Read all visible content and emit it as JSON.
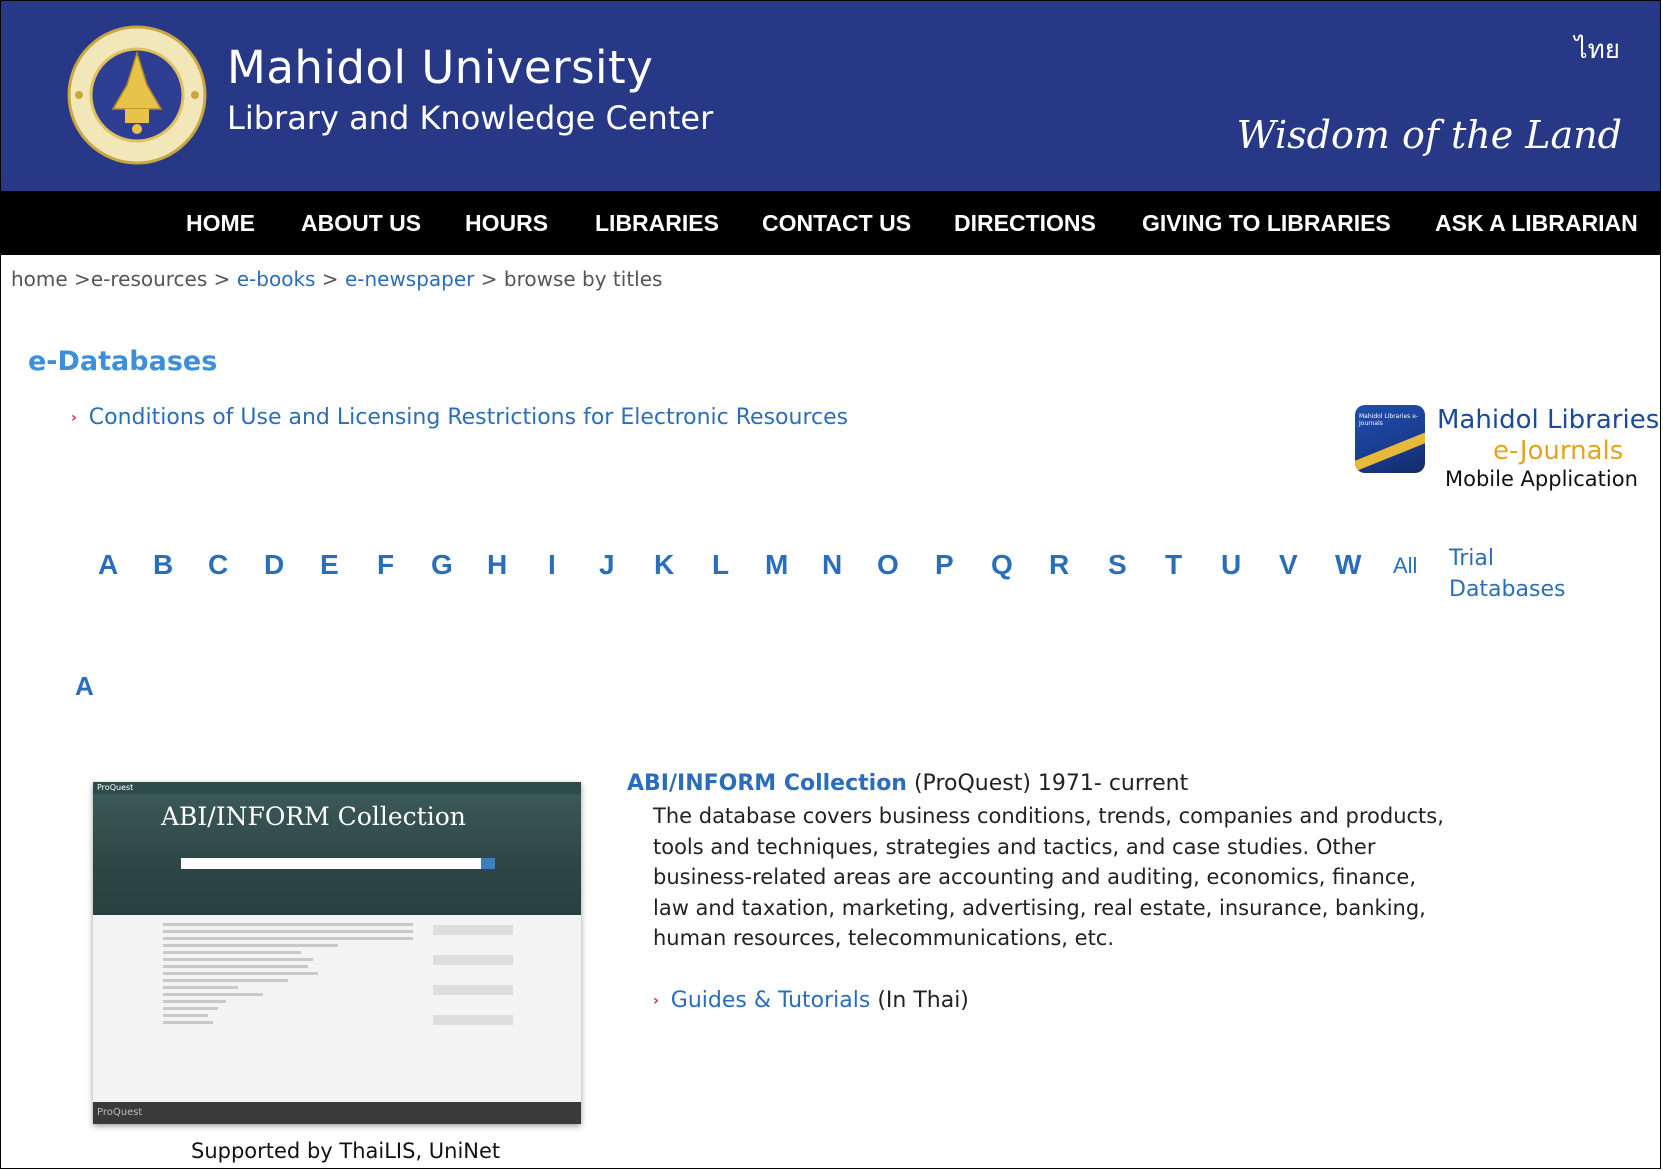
{
  "header": {
    "title": "Mahidol University",
    "subtitle": "Library and Knowledge Center",
    "lang_link": "ไทย",
    "tagline": "Wisdom of the Land",
    "colors": {
      "header_bg": "#273887",
      "nav_bg": "#000000",
      "link": "#2a6ebb",
      "title_blue": "#3d8fd9"
    }
  },
  "nav": [
    "HOME",
    "ABOUT US",
    "HOURS",
    "LIBRARIES",
    "CONTACT US",
    "DIRECTIONS",
    "GIVING TO LIBRARIES",
    "ASK A LIBRARIAN"
  ],
  "breadcrumb": {
    "home": "home >",
    "eresources": "e-resources > ",
    "ebooks": "e-books",
    "sep1": " > ",
    "enewspaper": "e-newspaper",
    "sep2": " > ",
    "current": "browse by titles"
  },
  "page_title": "e-Databases",
  "conditions_link": "Conditions of Use and Licensing Restrictions for Electronic Resources",
  "app_badge": {
    "icon_text": "Mahidol Libraries e-Journals",
    "line1": "Mahidol Libraries",
    "line2": "e-Journals",
    "line3": "Mobile Application"
  },
  "alphabet": [
    "A",
    "B",
    "C",
    "D",
    "E",
    "F",
    "G",
    "H",
    "I",
    "J",
    "K",
    "L",
    "M",
    "N",
    "O",
    "P",
    "Q",
    "R",
    "S",
    "T",
    "U",
    "V",
    "W"
  ],
  "alphabet_all": "All",
  "trial": {
    "line1": "Trial",
    "line2": "Databases"
  },
  "section_letter": "A",
  "database": {
    "thumbnail": {
      "logo": "ProQuest",
      "title": "ABI/INFORM Collection",
      "footer_logo": "ProQuest"
    },
    "supported_by": "Supported by ThaiLIS, UniNet",
    "title": "ABI/INFORM Collection",
    "meta": " (ProQuest) 1971- current",
    "description": "The database covers business conditions, trends, companies and products, tools and techniques, strategies and tactics, and case studies. Other business-related areas are accounting and auditing, economics, finance, law and taxation, marketing, advertising, real estate, insurance, banking, human resources, telecommunications, etc.",
    "guides_link": "Guides & Tutorials",
    "guides_note": " (In Thai)"
  }
}
